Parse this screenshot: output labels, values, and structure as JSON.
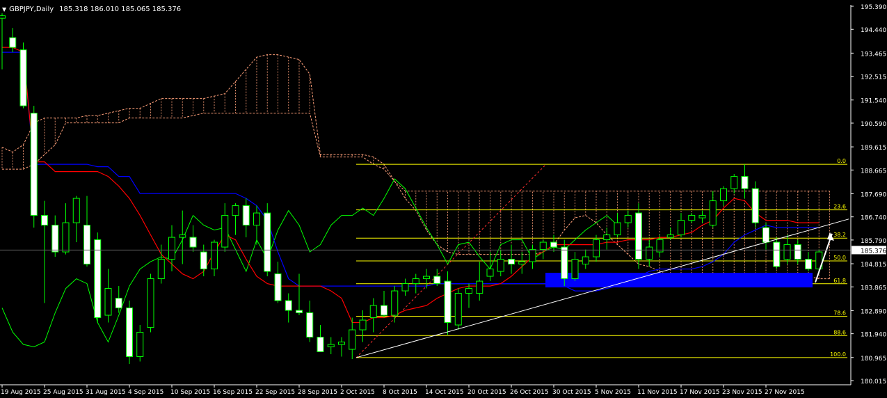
{
  "header": {
    "symbol_timeframe": "GBPJPY,Daily",
    "ohlc": "185.318 186.010 185.065 185.376"
  },
  "chart_data": {
    "type": "candlestick",
    "ylim": [
      180.015,
      195.39
    ],
    "y_ticks": [
      "195.390",
      "194.440",
      "193.465",
      "192.515",
      "191.540",
      "190.590",
      "189.615",
      "188.665",
      "187.690",
      "186.740",
      "185.790",
      "184.815",
      "183.865",
      "182.890",
      "181.940",
      "180.965",
      "180.015"
    ],
    "current_price": "185.376",
    "x_tick_labels": [
      "19 Aug 2015",
      "25 Aug 2015",
      "31 Aug 2015",
      "4 Sep 2015",
      "10 Sep 2015",
      "16 Sep 2015",
      "22 Sep 2015",
      "28 Sep 2015",
      "2 Oct 2015",
      "8 Oct 2015",
      "14 Oct 2015",
      "20 Oct 2015",
      "26 Oct 2015",
      "30 Oct 2015",
      "5 Nov 2015",
      "11 Nov 2015",
      "17 Nov 2015",
      "23 Nov 2015",
      "27 Nov 2015"
    ],
    "candles": [
      {
        "o": 194.9,
        "h": 195.1,
        "l": 192.8,
        "c": 195.0
      },
      {
        "o": 194.1,
        "h": 194.5,
        "l": 193.5,
        "c": 193.7
      },
      {
        "o": 193.6,
        "h": 193.9,
        "l": 191.2,
        "c": 191.3
      },
      {
        "o": 191.0,
        "h": 191.3,
        "l": 186.3,
        "c": 186.8
      },
      {
        "o": 186.8,
        "h": 187.4,
        "l": 183.2,
        "c": 186.4
      },
      {
        "o": 186.4,
        "h": 186.8,
        "l": 185.1,
        "c": 185.3
      },
      {
        "o": 185.3,
        "h": 187.3,
        "l": 185.2,
        "c": 186.5
      },
      {
        "o": 186.5,
        "h": 187.6,
        "l": 185.7,
        "c": 187.5
      },
      {
        "o": 186.4,
        "h": 187.6,
        "l": 184.7,
        "c": 184.8
      },
      {
        "o": 185.8,
        "h": 186.1,
        "l": 182.4,
        "c": 182.6
      },
      {
        "o": 182.7,
        "h": 184.6,
        "l": 182.4,
        "c": 183.8
      },
      {
        "o": 183.4,
        "h": 183.9,
        "l": 182.8,
        "c": 183.0
      },
      {
        "o": 183.0,
        "h": 183.3,
        "l": 180.7,
        "c": 181.0
      },
      {
        "o": 181.0,
        "h": 182.3,
        "l": 180.8,
        "c": 182.0
      },
      {
        "o": 182.2,
        "h": 184.4,
        "l": 182.0,
        "c": 184.2
      },
      {
        "o": 184.2,
        "h": 185.6,
        "l": 184.0,
        "c": 185.0
      },
      {
        "o": 185.0,
        "h": 186.4,
        "l": 184.5,
        "c": 185.9
      },
      {
        "o": 185.9,
        "h": 187.0,
        "l": 184.8,
        "c": 186.0
      },
      {
        "o": 185.9,
        "h": 186.4,
        "l": 185.3,
        "c": 185.5
      },
      {
        "o": 185.3,
        "h": 185.6,
        "l": 184.3,
        "c": 184.6
      },
      {
        "o": 184.6,
        "h": 185.8,
        "l": 184.3,
        "c": 185.7
      },
      {
        "o": 185.5,
        "h": 187.3,
        "l": 185.3,
        "c": 186.8
      },
      {
        "o": 186.8,
        "h": 187.3,
        "l": 186.0,
        "c": 187.2
      },
      {
        "o": 187.2,
        "h": 187.5,
        "l": 185.9,
        "c": 186.4
      },
      {
        "o": 186.4,
        "h": 187.2,
        "l": 185.6,
        "c": 186.9
      },
      {
        "o": 186.9,
        "h": 187.3,
        "l": 184.3,
        "c": 184.5
      },
      {
        "o": 184.4,
        "h": 184.9,
        "l": 183.2,
        "c": 183.3
      },
      {
        "o": 183.3,
        "h": 183.6,
        "l": 182.4,
        "c": 182.9
      },
      {
        "o": 182.9,
        "h": 184.4,
        "l": 182.7,
        "c": 182.8
      },
      {
        "o": 182.8,
        "h": 183.3,
        "l": 181.6,
        "c": 181.8
      },
      {
        "o": 181.8,
        "h": 182.3,
        "l": 181.2,
        "c": 181.2
      },
      {
        "o": 181.4,
        "h": 181.8,
        "l": 181.1,
        "c": 181.5
      },
      {
        "o": 181.5,
        "h": 181.8,
        "l": 181.0,
        "c": 181.6
      },
      {
        "o": 181.3,
        "h": 182.6,
        "l": 180.9,
        "c": 182.1
      },
      {
        "o": 182.1,
        "h": 182.9,
        "l": 181.6,
        "c": 182.5
      },
      {
        "o": 182.6,
        "h": 183.4,
        "l": 182.0,
        "c": 183.1
      },
      {
        "o": 183.1,
        "h": 183.7,
        "l": 182.6,
        "c": 182.7
      },
      {
        "o": 182.7,
        "h": 183.9,
        "l": 182.4,
        "c": 183.7
      },
      {
        "o": 183.7,
        "h": 184.2,
        "l": 183.5,
        "c": 184.0
      },
      {
        "o": 184.0,
        "h": 184.4,
        "l": 183.6,
        "c": 184.2
      },
      {
        "o": 184.2,
        "h": 184.6,
        "l": 183.8,
        "c": 184.3
      },
      {
        "o": 184.3,
        "h": 184.6,
        "l": 183.9,
        "c": 184.0
      },
      {
        "o": 184.1,
        "h": 184.5,
        "l": 181.9,
        "c": 182.4
      },
      {
        "o": 182.3,
        "h": 183.8,
        "l": 182.1,
        "c": 183.6
      },
      {
        "o": 183.6,
        "h": 184.0,
        "l": 183.0,
        "c": 183.8
      },
      {
        "o": 183.6,
        "h": 184.9,
        "l": 183.3,
        "c": 184.1
      },
      {
        "o": 184.3,
        "h": 185.3,
        "l": 184.1,
        "c": 184.6
      },
      {
        "o": 184.5,
        "h": 185.4,
        "l": 184.3,
        "c": 185.0
      },
      {
        "o": 185.0,
        "h": 185.6,
        "l": 184.4,
        "c": 184.8
      },
      {
        "o": 184.8,
        "h": 185.3,
        "l": 184.4,
        "c": 184.9
      },
      {
        "o": 184.9,
        "h": 185.6,
        "l": 184.6,
        "c": 185.4
      },
      {
        "o": 185.4,
        "h": 185.8,
        "l": 185.0,
        "c": 185.7
      },
      {
        "o": 185.7,
        "h": 186.0,
        "l": 185.3,
        "c": 185.5
      },
      {
        "o": 185.5,
        "h": 185.8,
        "l": 183.9,
        "c": 184.2
      },
      {
        "o": 184.2,
        "h": 185.3,
        "l": 184.1,
        "c": 185.0
      },
      {
        "o": 184.8,
        "h": 185.4,
        "l": 184.6,
        "c": 185.1
      },
      {
        "o": 185.1,
        "h": 186.0,
        "l": 184.9,
        "c": 185.8
      },
      {
        "o": 185.8,
        "h": 186.3,
        "l": 185.4,
        "c": 186.0
      },
      {
        "o": 186.0,
        "h": 186.9,
        "l": 185.9,
        "c": 186.5
      },
      {
        "o": 186.5,
        "h": 187.0,
        "l": 186.3,
        "c": 186.8
      },
      {
        "o": 186.9,
        "h": 187.3,
        "l": 184.6,
        "c": 185.0
      },
      {
        "o": 185.0,
        "h": 185.8,
        "l": 184.7,
        "c": 185.5
      },
      {
        "o": 185.3,
        "h": 186.0,
        "l": 185.1,
        "c": 185.8
      },
      {
        "o": 185.9,
        "h": 186.3,
        "l": 185.8,
        "c": 186.0
      },
      {
        "o": 186.0,
        "h": 186.9,
        "l": 185.9,
        "c": 186.6
      },
      {
        "o": 186.6,
        "h": 186.9,
        "l": 186.5,
        "c": 186.8
      },
      {
        "o": 186.7,
        "h": 187.0,
        "l": 186.5,
        "c": 186.8
      },
      {
        "o": 186.4,
        "h": 187.8,
        "l": 186.3,
        "c": 187.4
      },
      {
        "o": 187.4,
        "h": 188.0,
        "l": 187.2,
        "c": 187.9
      },
      {
        "o": 187.9,
        "h": 188.5,
        "l": 187.7,
        "c": 188.4
      },
      {
        "o": 188.4,
        "h": 188.9,
        "l": 187.5,
        "c": 187.9
      },
      {
        "o": 187.9,
        "h": 188.2,
        "l": 186.3,
        "c": 186.5
      },
      {
        "o": 186.3,
        "h": 186.5,
        "l": 185.4,
        "c": 185.7
      },
      {
        "o": 185.7,
        "h": 185.9,
        "l": 184.6,
        "c": 184.7
      },
      {
        "o": 185.0,
        "h": 186.0,
        "l": 184.8,
        "c": 185.6
      },
      {
        "o": 185.6,
        "h": 185.8,
        "l": 184.8,
        "c": 185.0
      },
      {
        "o": 185.0,
        "h": 185.3,
        "l": 184.5,
        "c": 184.6
      },
      {
        "o": 184.6,
        "h": 185.4,
        "l": 184.4,
        "c": 185.3
      }
    ],
    "tenkan": [
      193.7,
      193.7,
      193.5,
      189.0,
      189.0,
      188.6,
      188.6,
      188.6,
      188.6,
      188.6,
      188.4,
      188.0,
      187.5,
      186.8,
      186.0,
      185.2,
      184.8,
      184.4,
      184.2,
      184.5,
      185.3,
      186.0,
      185.8,
      185.0,
      184.3,
      184.0,
      183.9,
      183.9,
      183.9,
      183.9,
      183.9,
      183.7,
      183.4,
      182.4,
      182.4,
      182.6,
      182.6,
      182.7,
      182.9,
      183.0,
      183.1,
      183.4,
      183.6,
      183.8,
      183.9,
      183.9,
      183.9,
      184.0,
      184.3,
      184.7,
      185.1,
      185.3,
      185.6,
      185.6,
      185.6,
      185.6,
      185.6,
      185.7,
      185.7,
      185.8,
      185.8,
      185.8,
      185.9,
      185.9,
      186.0,
      186.1,
      186.4,
      186.6,
      187.1,
      187.5,
      187.4,
      186.9,
      186.6,
      186.6,
      186.6,
      186.5,
      186.5,
      186.5
    ],
    "kijun": [
      193.5,
      193.5,
      193.5,
      188.9,
      188.9,
      188.9,
      188.9,
      188.9,
      188.9,
      188.8,
      188.8,
      188.4,
      188.4,
      187.7,
      187.7,
      187.7,
      187.7,
      187.7,
      187.7,
      187.7,
      187.7,
      187.7,
      187.7,
      187.5,
      187.2,
      186.6,
      185.3,
      184.2,
      183.9,
      183.9,
      183.9,
      183.9,
      183.9,
      183.9,
      183.9,
      183.9,
      183.9,
      183.9,
      183.9,
      183.9,
      183.9,
      184.0,
      184.0,
      184.0,
      184.0,
      184.0,
      184.0,
      184.0,
      184.0,
      184.0,
      184.0,
      184.0,
      184.0,
      183.9,
      183.7,
      183.7,
      183.7,
      183.8,
      183.9,
      184.1,
      184.3,
      184.5,
      184.6,
      184.6,
      184.6,
      184.6,
      184.7,
      184.9,
      185.2,
      185.7,
      186.0,
      186.2,
      186.4,
      186.3,
      186.3,
      186.3,
      186.3,
      186.3
    ],
    "chikou": [
      183.0,
      182.0,
      181.5,
      181.4,
      181.6,
      182.8,
      183.8,
      184.2,
      184.0,
      182.4,
      181.6,
      182.7,
      183.9,
      184.6,
      184.9,
      185.1,
      185.0,
      185.8,
      186.8,
      186.4,
      186.2,
      186.3,
      185.4,
      184.5,
      185.8,
      185.0,
      186.2,
      187.0,
      186.4,
      185.3,
      185.6,
      186.4,
      186.8,
      186.8,
      187.1,
      186.8,
      187.5,
      188.3,
      187.9,
      187.1,
      186.3,
      185.6,
      184.8,
      185.6,
      185.7,
      185.1,
      184.6,
      185.6,
      185.8,
      185.8,
      185.0,
      185.3,
      185.5,
      185.4,
      185.8,
      186.2,
      186.5,
      186.8,
      186.4
    ],
    "kumo_span_a": [
      189.6,
      189.4,
      189.7,
      190.6,
      190.8,
      190.8,
      190.8,
      190.8,
      190.9,
      190.9,
      191.0,
      191.1,
      191.2,
      191.2,
      191.4,
      191.6,
      191.6,
      191.6,
      191.6,
      191.6,
      191.7,
      191.8,
      192.3,
      192.8,
      193.3,
      193.4,
      193.4,
      193.3,
      193.2,
      192.6,
      189.3,
      189.3,
      189.3,
      189.3,
      189.3,
      189.2,
      188.9,
      188.2,
      187.5,
      187.0,
      186.2,
      185.6,
      185.3,
      185.2,
      185.2,
      185.2,
      185.2,
      185.2,
      185.2,
      185.2,
      185.2,
      185.3,
      185.6,
      186.2,
      186.7,
      186.8,
      186.5,
      186.0,
      185.6,
      185.2,
      184.8,
      184.7,
      184.5,
      184.3,
      184.3,
      184.3,
      184.3,
      184.3,
      184.3,
      184.3,
      184.4,
      184.4,
      184.4,
      184.4,
      184.4,
      184.3,
      184.3,
      184.2,
      184.2
    ],
    "kumo_span_b": [
      188.7,
      188.7,
      188.7,
      188.9,
      189.3,
      189.7,
      190.6,
      190.6,
      190.6,
      190.6,
      190.6,
      190.6,
      190.8,
      190.8,
      190.8,
      190.8,
      190.8,
      190.8,
      190.9,
      191.0,
      191.0,
      191.0,
      191.0,
      191.0,
      191.0,
      191.0,
      191.0,
      191.0,
      191.0,
      191.0,
      189.2,
      189.2,
      189.2,
      189.2,
      189.2,
      188.9,
      188.7,
      188.2,
      187.8,
      187.8,
      187.8,
      187.8,
      187.8,
      187.8,
      187.8,
      187.8,
      187.8,
      187.8,
      187.8,
      187.8,
      187.8,
      187.8,
      187.8,
      187.8,
      187.8,
      187.8,
      187.8,
      187.8,
      187.8,
      187.8,
      187.8,
      187.8,
      187.8,
      187.8,
      187.8,
      187.8,
      187.8,
      187.8,
      187.8,
      187.8,
      187.8,
      187.8,
      187.8,
      187.8,
      187.8,
      187.8,
      187.8,
      187.8,
      187.8
    ],
    "fibonacci": {
      "high": 188.9,
      "low": 180.96,
      "levels": [
        {
          "label": "0.0",
          "ratio": 0.0
        },
        {
          "label": "23.6",
          "ratio": 0.236
        },
        {
          "label": "38.2",
          "ratio": 0.382
        },
        {
          "label": "50.0",
          "ratio": 0.5
        },
        {
          "label": "61.8",
          "ratio": 0.618
        },
        {
          "label": "78.6",
          "ratio": 0.786
        },
        {
          "label": "88.6",
          "ratio": 0.886
        },
        {
          "label": "100.0",
          "ratio": 1.0
        }
      ]
    },
    "colors": {
      "background": "#000000",
      "candle_fill": "#ffffff",
      "candle_outline": "#00ff00",
      "tenkan": "#ff0000",
      "kijun": "#0000ff",
      "chikou": "#00ff00",
      "kumo": "#ffa07a",
      "fibonacci": "#ffff00",
      "trendline": "#ffffff",
      "support_zone": "#0000ff",
      "axis_text": "#ffffff"
    }
  }
}
